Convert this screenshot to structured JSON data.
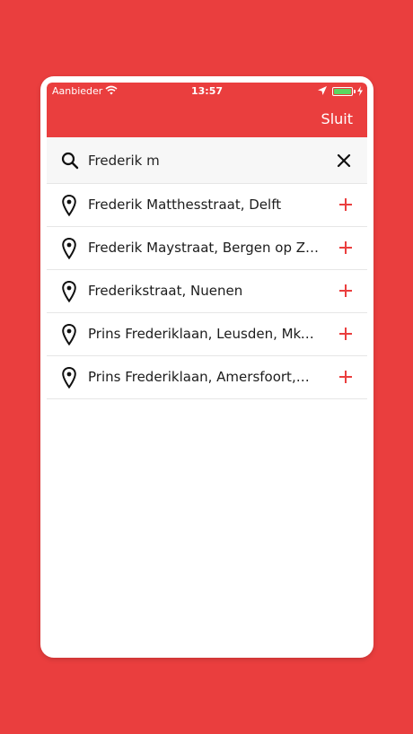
{
  "status_bar": {
    "carrier": "Aanbieder",
    "time": "13:57"
  },
  "header": {
    "close_label": "Sluit",
    "background_color": "#ea3e3e"
  },
  "search": {
    "value": "Frederik m",
    "placeholder": ""
  },
  "results": [
    {
      "label": "Frederik Matthesstraat, Delft"
    },
    {
      "label": "Frederik Maystraat, Bergen op Zoom"
    },
    {
      "label": "Frederikstraat, Nuenen"
    },
    {
      "label": "Prins Frederiklaan, Leusden, Mkoa…"
    },
    {
      "label": "Prins Frederiklaan, Amersfoort,…"
    }
  ],
  "icons": {
    "search": "search-icon",
    "clear": "close-icon",
    "result_marker": "map-pin-icon",
    "add": "plus-icon"
  },
  "colors": {
    "accent": "#ea3e3e",
    "battery": "#59d65f"
  }
}
